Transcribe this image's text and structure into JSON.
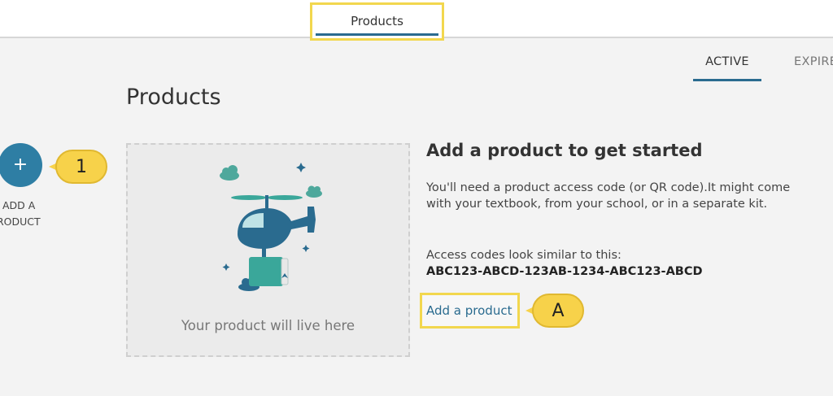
{
  "header": {
    "tab_label": "Products"
  },
  "filters": {
    "active_label": "ACTIVE",
    "expired_label": "EXPIRE"
  },
  "page": {
    "title": "Products"
  },
  "add_button": {
    "icon_glyph": "+",
    "label_line1": "ADD A",
    "label_line2": "RODUCT"
  },
  "callouts": {
    "one": "1",
    "a": "A"
  },
  "placeholder": {
    "caption": "Your product will live here"
  },
  "info": {
    "heading": "Add a product to get started",
    "body": "You'll need a product access code (or QR code).It might come with your textbook, from your school, or in a separate kit.",
    "codes_label": "Access codes look similar to this:",
    "code_example": "ABC123-ABCD-123AB-1234-ABC123-ABCD",
    "link": "Add a product"
  },
  "colors": {
    "accent": "#2a6b8f",
    "fab": "#2e7ea4",
    "highlight": "#f2d74e",
    "callout": "#f7d24a",
    "teal": "#3aa79a",
    "cloud": "#4ea89c"
  }
}
